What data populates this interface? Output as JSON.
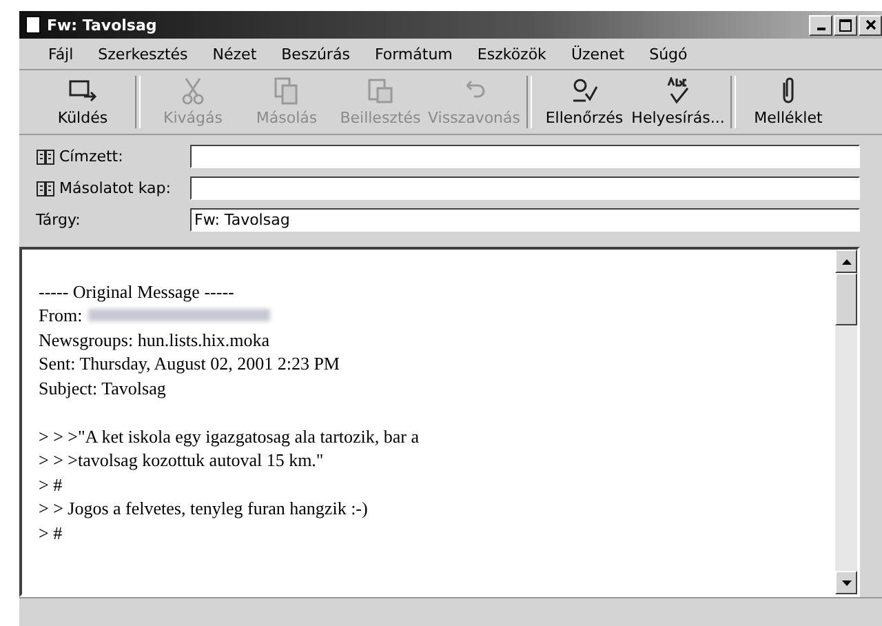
{
  "window": {
    "title": "Fw: Tavolsag"
  },
  "menu": [
    "Fájl",
    "Szerkesztés",
    "Nézet",
    "Beszúrás",
    "Formátum",
    "Eszközök",
    "Üzenet",
    "Súgó"
  ],
  "toolbar": [
    {
      "label": "Küldés",
      "kind": "send",
      "disabled": false
    },
    {
      "label": "Kivágás",
      "kind": "cut",
      "disabled": true
    },
    {
      "label": "Másolás",
      "kind": "copy",
      "disabled": true
    },
    {
      "label": "Beillesztés",
      "kind": "paste",
      "disabled": true
    },
    {
      "label": "Visszavonás",
      "kind": "undo",
      "disabled": true
    },
    {
      "label": "Ellenőrzés",
      "kind": "check",
      "disabled": false
    },
    {
      "label": "Helyesírás...",
      "kind": "spell",
      "disabled": false
    },
    {
      "label": "Melléklet",
      "kind": "attach",
      "disabled": false
    }
  ],
  "fields": [
    {
      "label": "Címzett:",
      "book": true
    },
    {
      "label": "Másolatot kap:",
      "book": true
    },
    {
      "label": "Tárgy:",
      "book": false,
      "value": "Fw: Tavolsag"
    }
  ],
  "body": {
    "lines": [
      {
        "kind": "blank"
      },
      {
        "kind": "text",
        "text": "----- Original Message -----"
      },
      {
        "kind": "redacted",
        "text": "From:"
      },
      {
        "kind": "text",
        "text": "Newsgroups: hun.lists.hix.moka"
      },
      {
        "kind": "text",
        "text": "Sent: Thursday, August 02, 2001 2:23 PM"
      },
      {
        "kind": "text",
        "text": "Subject: Tavolsag"
      },
      {
        "kind": "blank"
      },
      {
        "kind": "text",
        "text": "> > >\"A ket iskola egy igazgatosag ala tartozik, bar a"
      },
      {
        "kind": "text",
        "text": "> > >tavolsag kozottuk autoval 15 km.\""
      },
      {
        "kind": "text",
        "text": "> #"
      },
      {
        "kind": "text",
        "text": "> > Jogos a felvetes, tenyleg furan hangzik :-)"
      },
      {
        "kind": "text",
        "text": "> #"
      }
    ]
  }
}
